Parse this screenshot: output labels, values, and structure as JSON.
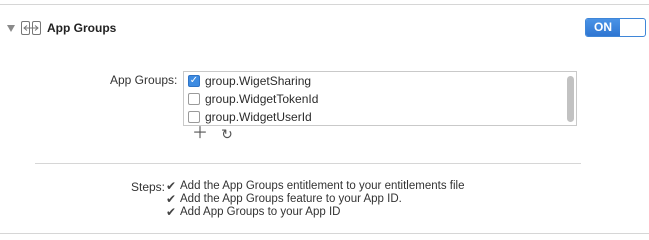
{
  "section": {
    "title": "App Groups",
    "toggle_label": "ON",
    "accent_color": "#3d8be1"
  },
  "app_groups": {
    "label": "App Groups:",
    "items": [
      {
        "name": "group.WigetSharing",
        "checked": true
      },
      {
        "name": "group.WidgetTokenId",
        "checked": false
      },
      {
        "name": "group.WidgetUserId",
        "checked": false
      }
    ],
    "add_icon": "plus-icon",
    "refresh_icon": "refresh-icon"
  },
  "steps": {
    "label": "Steps:",
    "items": [
      "Add the App Groups entitlement to your entitlements file",
      "Add the App Groups feature to your App ID.",
      "Add App Groups to your App ID"
    ]
  }
}
